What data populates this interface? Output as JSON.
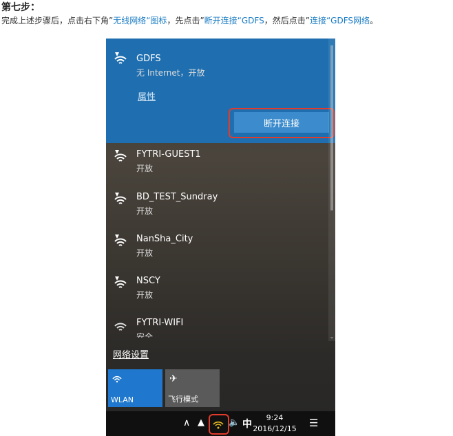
{
  "heading": "第七步：",
  "instruction": {
    "p1": "完成上述步骤后，点击右下角”",
    "h1": "无线网络“图标",
    "p2": "，先点击”",
    "h2": "断开连接“GDFS",
    "p3": "，然后点击”",
    "h3": "连接“GDFS网络",
    "p4": "。"
  },
  "connected": {
    "name": "GDFS",
    "status": "无 Internet，开放",
    "properties_link": "属性",
    "disconnect_label": "断开连接"
  },
  "networks": [
    {
      "name": "FYTRI-GUEST1",
      "status": "开放"
    },
    {
      "name": "BD_TEST_Sundray",
      "status": "开放"
    },
    {
      "name": "NanSha_City",
      "status": "开放"
    },
    {
      "name": "NSCY",
      "status": "开放"
    },
    {
      "name": "FYTRI-WIFI",
      "status": "安全"
    }
  ],
  "network_settings_link": "网络设置",
  "quick_actions": [
    {
      "label": "WLAN",
      "icon": "wifi-icon"
    },
    {
      "label": "飞行模式",
      "icon": "airplane-icon"
    }
  ],
  "taskbar": {
    "ime": "中",
    "time": "9:24",
    "date": "2016/12/15"
  },
  "colors": {
    "accent": "#1f6fb0",
    "highlight_text": "#1a7cc4",
    "annotation_red": "#e23b2b"
  }
}
